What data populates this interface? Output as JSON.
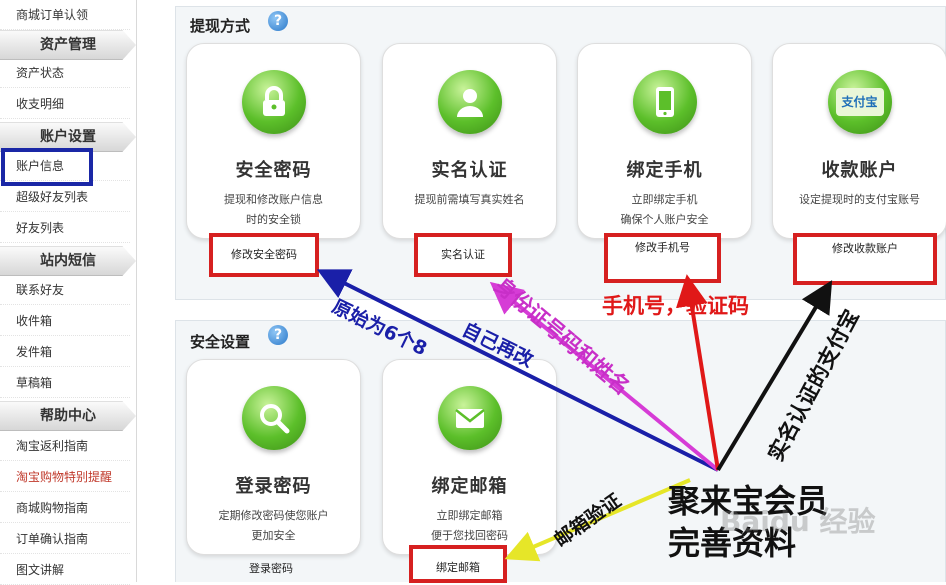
{
  "sidebar": {
    "items": [
      {
        "label": "商城订单认领"
      },
      {
        "label": "资产状态"
      },
      {
        "label": "收支明细"
      },
      {
        "label": "账户信息"
      },
      {
        "label": "超级好友列表"
      },
      {
        "label": "好友列表"
      },
      {
        "label": "联系好友"
      },
      {
        "label": "收件箱"
      },
      {
        "label": "发件箱"
      },
      {
        "label": "草稿箱"
      },
      {
        "label": "淘宝返利指南"
      },
      {
        "label": "淘宝购物特别提醒"
      },
      {
        "label": "商城购物指南"
      },
      {
        "label": "订单确认指南"
      },
      {
        "label": "图文讲解"
      }
    ],
    "sections": [
      {
        "label": "资产管理"
      },
      {
        "label": "账户设置"
      },
      {
        "label": "站内短信"
      },
      {
        "label": "帮助中心"
      }
    ]
  },
  "withdraw": {
    "title": "提现方式",
    "help": "?",
    "cards": [
      {
        "icon": "lock-icon",
        "title": "安全密码",
        "desc1": "提现和修改账户信息",
        "desc2": "时的安全锁",
        "link": "修改安全密码"
      },
      {
        "icon": "user-icon",
        "title": "实名认证",
        "desc1": "提现前需填写真实姓名",
        "desc2": "",
        "link": "实名认证"
      },
      {
        "icon": "phone-icon",
        "title": "绑定手机",
        "desc1": "立即绑定手机",
        "desc2": "确保个人账户安全",
        "link": "修改手机号"
      },
      {
        "icon": "alipay-icon",
        "title": "收款账户",
        "desc1": "设定提现时的支付宝账号",
        "desc2": "",
        "link": "修改收款账户",
        "logo_text": "支付宝"
      }
    ]
  },
  "security": {
    "title": "安全设置",
    "help": "?",
    "cards": [
      {
        "icon": "magnifier-icon",
        "title": "登录密码",
        "desc1": "定期修改密码使您账户",
        "desc2": "更加安全",
        "link": "登录密码"
      },
      {
        "icon": "mail-icon",
        "title": "绑定邮箱",
        "desc1": "立即绑定邮箱",
        "desc2": "便于您找回密码",
        "link": "绑定邮箱"
      }
    ]
  },
  "annotations": {
    "a1": "原始为6个8",
    "a2": "自己再改",
    "a3": "身份证号码和姓名",
    "a4": "手机号，验证码",
    "a5": "实名认证的支付宝",
    "a6": "邮箱验证",
    "center1": "聚来宝会员",
    "center2": "完善资料",
    "watermark": "Baidu 经验"
  },
  "colors": {
    "blue_box": "#1a27a6",
    "red_box": "#d62020",
    "green_icon": "#5cbf2a"
  }
}
